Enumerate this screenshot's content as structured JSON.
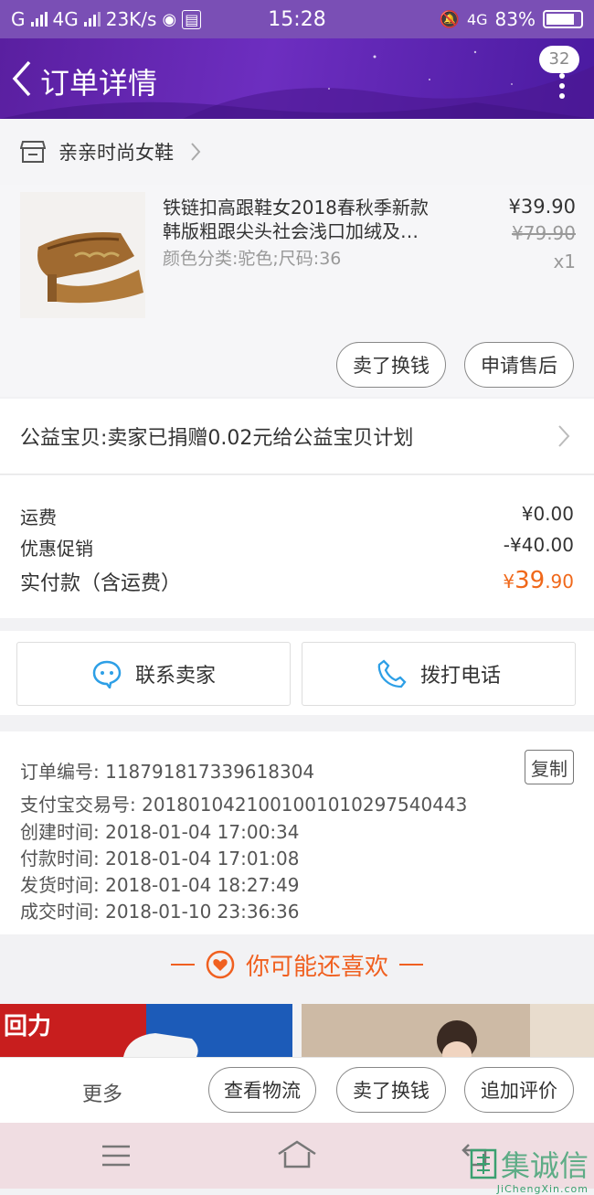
{
  "status_bar": {
    "carrier_left": "G",
    "network": "4G",
    "speed": "23K/s",
    "time": "15:28",
    "network_right": "4G",
    "battery": "83%",
    "battery_level": 0.83
  },
  "header": {
    "title": "订单详情",
    "badge_count": "32"
  },
  "shop": {
    "name": "亲亲时尚女鞋"
  },
  "product": {
    "title": "铁链扣高跟鞋女2018春秋季新款韩版粗跟尖头社会浅口加绒及…",
    "title_line1": "铁链扣高跟鞋女2018春秋季新款",
    "title_line2": "韩版粗跟尖头社会浅口加绒及…",
    "spec": "颜色分类:驼色;尺码:36",
    "price": "¥39.90",
    "original_price": "¥79.90",
    "quantity": "x1",
    "buttons": {
      "sell": "卖了换钱",
      "after_sale": "申请售后"
    }
  },
  "charity": {
    "text": "公益宝贝:卖家已捐赠0.02元给公益宝贝计划"
  },
  "fees": {
    "shipping_label": "运费",
    "shipping_value": "¥0.00",
    "discount_label": "优惠促销",
    "discount_value": "-¥40.00",
    "total_label": "实付款（含运费）",
    "total_currency": "¥",
    "total_int": "39",
    "total_dec": ".90"
  },
  "contact": {
    "seller": "联系卖家",
    "phone": "拨打电话"
  },
  "order_info": {
    "order_no": "订单编号: 118791817339618304",
    "alipay_no": "支付宝交易号: 2018010421001001010297540443",
    "created": "创建时间: 2018-01-04 17:00:34",
    "paid": "付款时间: 2018-01-04 17:01:08",
    "shipped": "发货时间: 2018-01-04 18:27:49",
    "completed": "成交时间: 2018-01-10 23:36:36",
    "copy_button": "复制"
  },
  "recommend": {
    "title": "你可能还喜欢",
    "brand_text": "回力"
  },
  "actions": {
    "more": "更多",
    "logistics": "查看物流",
    "sell": "卖了换钱",
    "review": "追加评价"
  },
  "watermark": {
    "text": "集诚信",
    "domain": "JiChengXin.com"
  },
  "colors": {
    "header_purple": "#6d2ec0",
    "accent_orange": "#f0681a"
  }
}
